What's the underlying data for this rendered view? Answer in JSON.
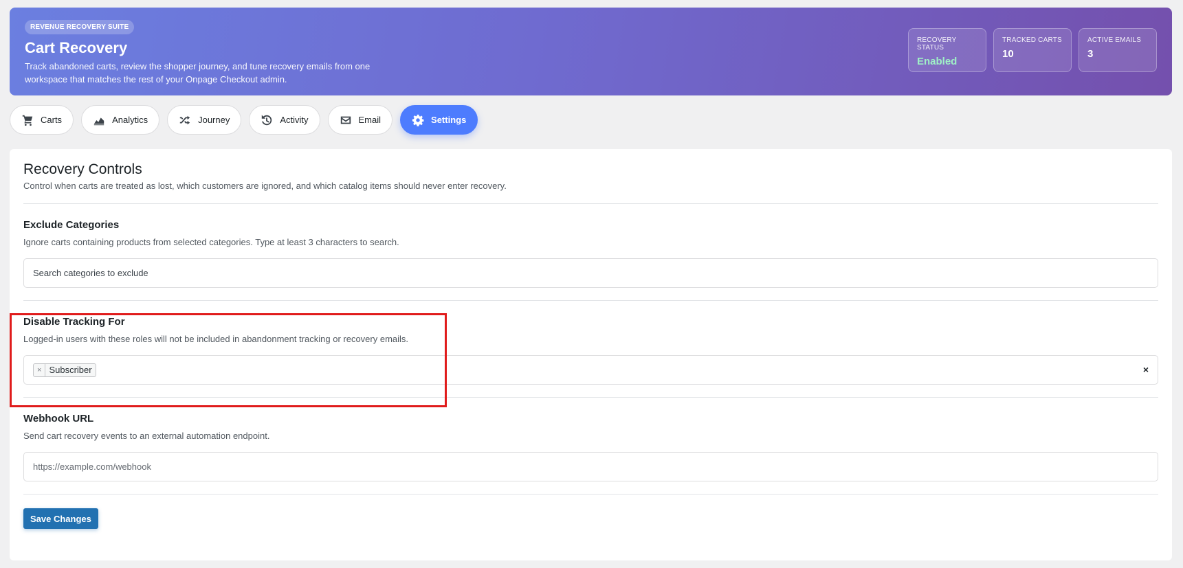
{
  "header": {
    "eyebrow": "REVENUE RECOVERY SUITE",
    "title": "Cart Recovery",
    "description": "Track abandoned carts, review the shopper journey, and tune recovery emails from one workspace that matches the rest of your Onpage Checkout admin.",
    "stats": [
      {
        "label": "RECOVERY STATUS",
        "value": "Enabled",
        "color": "#9ff0c6"
      },
      {
        "label": "TRACKED CARTS",
        "value": "10"
      },
      {
        "label": "ACTIVE EMAILS",
        "value": "3"
      }
    ]
  },
  "tabs": [
    {
      "label": "Carts",
      "icon": "cart-icon"
    },
    {
      "label": "Analytics",
      "icon": "chart-icon"
    },
    {
      "label": "Journey",
      "icon": "shuffle-icon"
    },
    {
      "label": "Activity",
      "icon": "history-icon"
    },
    {
      "label": "Email",
      "icon": "mail-icon"
    },
    {
      "label": "Settings",
      "icon": "gear-icon",
      "active": true
    }
  ],
  "panel": {
    "title": "Recovery Controls",
    "subtitle": "Control when carts are treated as lost, which customers are ignored, and which catalog items should never enter recovery.",
    "exclude_categories": {
      "label": "Exclude Categories",
      "help": "Ignore carts containing products from selected categories. Type at least 3 characters to search.",
      "placeholder": "Search categories to exclude"
    },
    "disable_tracking": {
      "label": "Disable Tracking For",
      "help": "Logged-in users with these roles will not be included in abandonment tracking or recovery emails.",
      "selected": [
        "Subscriber"
      ],
      "chip_remove": "×",
      "clear_all": "×"
    },
    "webhook": {
      "label": "Webhook URL",
      "help": "Send cart recovery events to an external automation endpoint.",
      "placeholder": "https://example.com/webhook"
    },
    "save_label": "Save Changes"
  },
  "colors": {
    "accent": "#4d7cfe",
    "save": "#2271b1",
    "highlight": "#e01b1b"
  }
}
